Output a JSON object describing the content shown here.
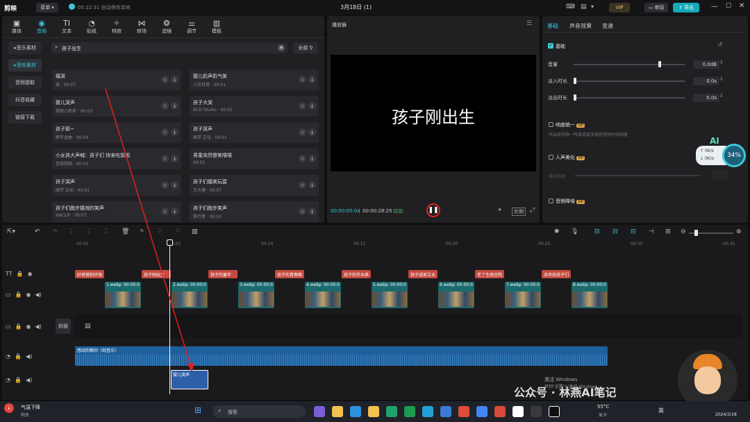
{
  "app": {
    "logo": "剪映",
    "menu_label": "菜单",
    "save_status": "05:22:31 自动保存本地",
    "project_title": "3月18日 (1)",
    "vip_label": "VIP",
    "review_label": "审阅",
    "export_label": "导出"
  },
  "media_tabs": [
    {
      "label": "媒体",
      "icon": "media-icon"
    },
    {
      "label": "音频",
      "icon": "audio-icon"
    },
    {
      "label": "文本",
      "icon": "text-icon"
    },
    {
      "label": "贴纸",
      "icon": "sticker-icon"
    },
    {
      "label": "特效",
      "icon": "effects-icon"
    },
    {
      "label": "转场",
      "icon": "transition-icon"
    },
    {
      "label": "滤镜",
      "icon": "filter-icon"
    },
    {
      "label": "调节",
      "icon": "adjust-icon"
    },
    {
      "label": "模板",
      "icon": "template-icon"
    }
  ],
  "audio_sidebar": [
    "音乐素材",
    "音效素材",
    "音频提取",
    "抖音收藏",
    "链接下载"
  ],
  "search": {
    "value": "孩子出生",
    "filter_label": "全部"
  },
  "sound_cards": [
    {
      "title": "痛哭",
      "sub": "哭 · 00:07"
    },
    {
      "title": "婴儿奶声奶气笑",
      "sub": "人间日常 · 00:01"
    },
    {
      "title": "婴儿哭声",
      "sub": "剪映小助手 · 00:03"
    },
    {
      "title": "孩子大哭",
      "sub": "BCD Studio · 00:01"
    },
    {
      "title": "孩子耶~",
      "sub": "醉年金曲 · 00:04"
    },
    {
      "title": "孩子哭声",
      "sub": "国学 文化 · 00:01"
    },
    {
      "title": "小女孩大声喊：孩子们 快来吃饭啦",
      "sub": "觉悟视频 · 00:03"
    },
    {
      "title": "男童突然傻笑嘻嘻",
      "sub": "00:01"
    },
    {
      "title": "孩子哭声",
      "sub": "国学 文化 · 00:01"
    },
    {
      "title": "孩子们嬉笑玩耍",
      "sub": "王大锤 · 00:07"
    },
    {
      "title": "孩子们跑步嬉戏的笑声",
      "sub": "XNCLIP · 00:07"
    },
    {
      "title": "孩子们跑步笑声",
      "sub": "移行者 · 00:02"
    }
  ],
  "player": {
    "title": "播放器",
    "caption": "孩子刚出生",
    "current_time": "00:00:05:04",
    "total_time": "00:00:28:25",
    "ratio_label": "比例"
  },
  "props": {
    "tabs": [
      "基础",
      "声音效果",
      "变速"
    ],
    "section_basic": "基础",
    "rows": [
      {
        "label": "音量",
        "value": "0.0dB",
        "level": 0.76
      },
      {
        "label": "淡入时长",
        "value": "0.0s",
        "level": 0.0
      },
      {
        "label": "淡出时长",
        "value": "0.0s",
        "level": 0.0
      }
    ],
    "loudness_label": "响度统一",
    "loudness_desc": "开启后可统一所单选或多选的音频片段响度",
    "voice_beautify_label": "人声美化",
    "beautify_strength_label": "美化强度",
    "noise_reduction_label": "音频降噪",
    "vip_tag": "VIP"
  },
  "net_monitor": {
    "ai_label": "AI",
    "up": "0K/s",
    "down": "0K/s",
    "cpu": "34%"
  },
  "timeline": {
    "ruler": [
      "00:00",
      "00:05",
      "00:10",
      "00:15",
      "00:20",
      "00:25",
      "00:30",
      "00:35"
    ],
    "text_clips": [
      "好爸爸和环境",
      "孩子刚出生",
      "孩子的童年",
      "孩子的青春期",
      "孩子的毕业典",
      "孩子成家立业",
      "老了生病住院",
      "去世后孩子们"
    ],
    "video_clips": [
      {
        "name": "1.webp",
        "dur": "00:00:0"
      },
      {
        "name": "2.webp",
        "dur": "00:00:0"
      },
      {
        "name": "3.webp",
        "dur": "00:00:0"
      },
      {
        "name": "4.webp",
        "dur": "00:00:0"
      },
      {
        "name": "5.webp",
        "dur": "00:00:0"
      },
      {
        "name": "6.webp",
        "dur": "00:00:0"
      },
      {
        "name": "7.webp",
        "dur": "00:00:0"
      },
      {
        "name": "8.webp",
        "dur": "00:00:0"
      }
    ],
    "cover_label": "封面",
    "music_clip_label": "感动的瞬间（纯音乐）",
    "sfx_clip_label": "婴儿哭声"
  },
  "watermark": "公众号 · 林燕AI笔记",
  "windows_activation": {
    "line1": "激活 Windows",
    "line2": "转到\"设置\"以激活 Windows。"
  },
  "taskbar": {
    "weather_title": "气温下降",
    "weather_sub": "明天",
    "search_placeholder": "搜索",
    "temp": "55°C",
    "temp_sub": "显卡",
    "ime": "英",
    "date": "2024/3/18"
  },
  "colors": {
    "accent": "#3ec6d6",
    "export_bg": "#13a9b8",
    "text_clip": "#c44a3f",
    "audio_clip": "#1f5f9a",
    "playhead": "#ffffff",
    "annotation": "#e02020"
  }
}
